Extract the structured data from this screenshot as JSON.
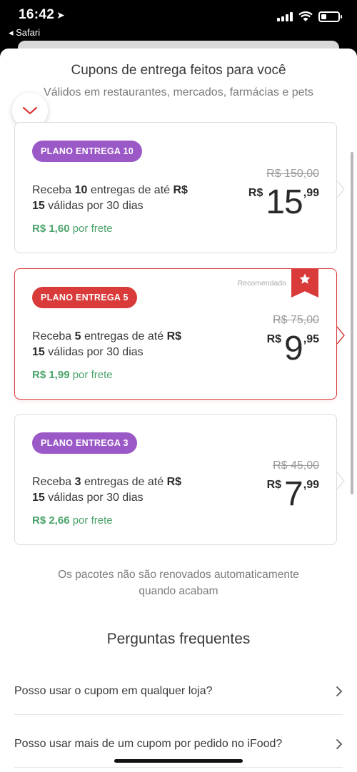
{
  "status_bar": {
    "time": "16:42",
    "back_app": "◂ Safari"
  },
  "sheet": {
    "title": "Cupons de entrega feitos para você",
    "subtitle": "Válidos em restaurantes, mercados, farmácias e pets"
  },
  "colors": {
    "purple": "#9b59c7",
    "red": "#d93a3a",
    "green": "#4aa36a"
  },
  "plans": [
    {
      "badge": "PLANO ENTREGA 10",
      "desc": {
        "p1": "Receba ",
        "n": "10",
        "p2": " entregas de até ",
        "cur": "R$",
        "amount": "15",
        "p3": " válidas por 30 dias"
      },
      "per_price": "R$ 1,60",
      "per_label": "por frete",
      "old_price": "R$ 150,00",
      "price": {
        "cur": "R$",
        "int": "15",
        "dec": ",99"
      }
    },
    {
      "badge": "PLANO ENTREGA 5",
      "recommended_label": "Recomendado",
      "desc": {
        "p1": "Receba ",
        "n": "5",
        "p2": " entregas de até ",
        "cur": "R$",
        "amount": "15",
        "p3": " válidas por 30 dias"
      },
      "per_price": "R$ 1,99",
      "per_label": "por frete",
      "old_price": "R$ 75,00",
      "price": {
        "cur": "R$",
        "int": "9",
        "dec": ",95"
      }
    },
    {
      "badge": "PLANO ENTREGA 3",
      "desc": {
        "p1": "Receba ",
        "n": "3",
        "p2": " entregas de até ",
        "cur": "R$",
        "amount": "15",
        "p3": " válidas por 30 dias"
      },
      "per_price": "R$ 2,66",
      "per_label": "por frete",
      "old_price": "R$ 45,00",
      "price": {
        "cur": "R$",
        "int": "7",
        "dec": ",99"
      }
    }
  ],
  "footnote": {
    "line1": "Os pacotes não são renovados automaticamente",
    "line2": "quando acabam"
  },
  "faq": {
    "title": "Perguntas frequentes",
    "items": [
      "Posso usar o cupom em qualquer loja?",
      "Posso usar mais de um cupom por pedido no iFood?"
    ]
  }
}
